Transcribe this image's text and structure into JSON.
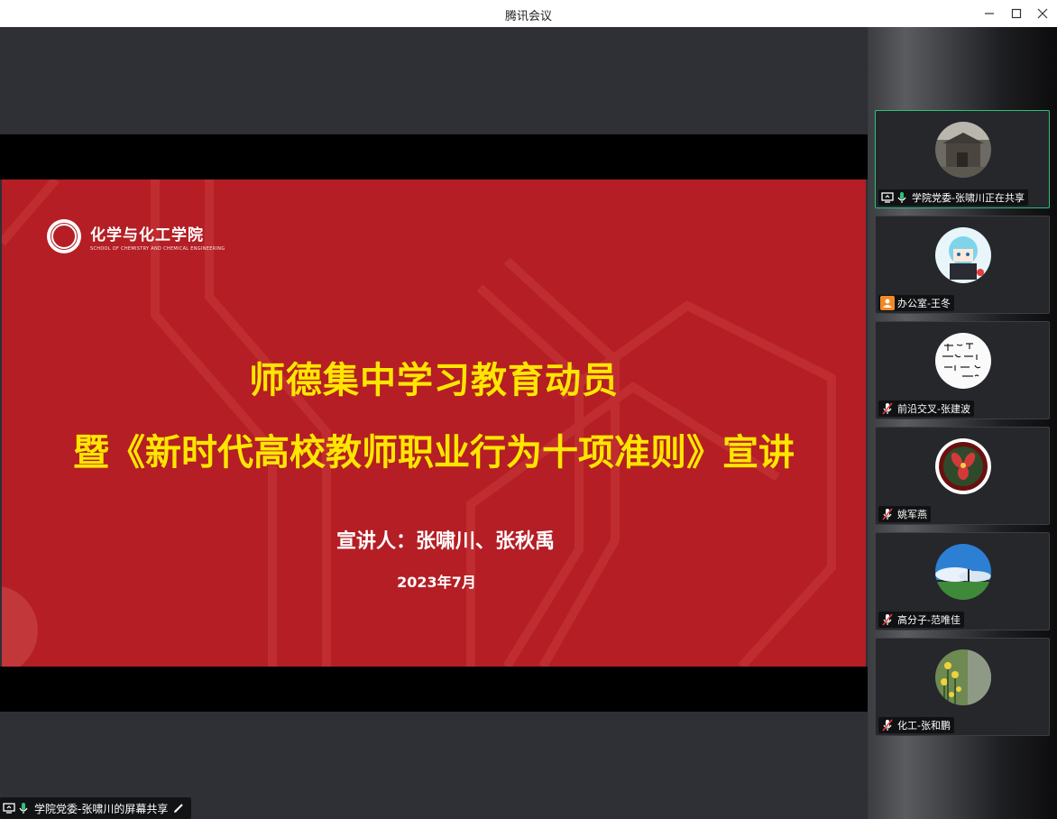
{
  "window": {
    "title": "腾讯会议"
  },
  "slide": {
    "logo_cn": "化学与化工学院",
    "logo_en": "SCHOOL OF CHEMISTRY AND CHEMICAL ENGINEERING",
    "title_line1": "师德集中学习教育动员",
    "title_line2": "暨《新时代高校教师职业行为十项准则》宣讲",
    "speakers": "宣讲人：张啸川、张秋禹",
    "date": "2023年7月",
    "colors": {
      "background": "#b41e24",
      "title": "#ffe600"
    }
  },
  "participants": [
    {
      "name": "学院党委-张啸川正在共享",
      "status": "sharing",
      "mic": "on",
      "avatar_icon": "building-photo-icon"
    },
    {
      "name": "办公室-王冬",
      "status": "host-badge",
      "mic": "none",
      "avatar_icon": "anime-character-icon"
    },
    {
      "name": "前沿交叉-张建波",
      "status": "normal",
      "mic": "muted",
      "avatar_icon": "calligraphy-icon"
    },
    {
      "name": "姚军燕",
      "status": "normal",
      "mic": "muted",
      "avatar_icon": "flower-icon"
    },
    {
      "name": "高分子-范唯佳",
      "status": "normal",
      "mic": "muted",
      "avatar_icon": "sky-landscape-icon"
    },
    {
      "name": "化工-张和鹏",
      "status": "normal",
      "mic": "muted",
      "avatar_icon": "yellow-flowers-icon"
    }
  ],
  "share_label": "学院党委-张啸川的屏幕共享",
  "accent_color": "#2fbf7a"
}
